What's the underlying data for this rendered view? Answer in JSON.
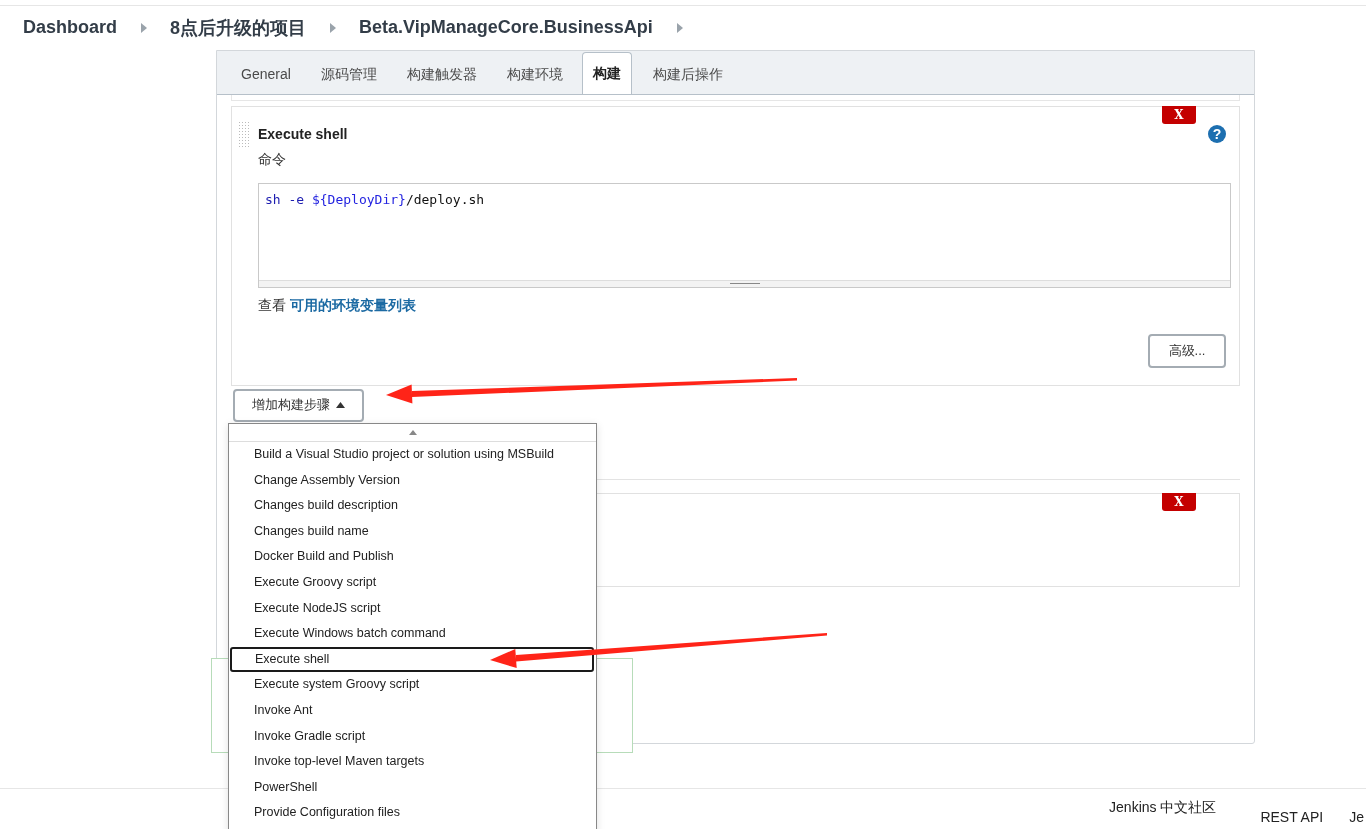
{
  "breadcrumb": [
    {
      "label": "Dashboard"
    },
    {
      "label": "8点后升级的项目"
    },
    {
      "label": "Beta.VipManageCore.BusinessApi"
    }
  ],
  "tabs": [
    {
      "label": "General",
      "selected": false
    },
    {
      "label": "源码管理",
      "selected": false
    },
    {
      "label": "构建触发器",
      "selected": false
    },
    {
      "label": "构建环境",
      "selected": false
    },
    {
      "label": "构建",
      "selected": true
    },
    {
      "label": "构建后操作",
      "selected": false
    }
  ],
  "build_steps": [
    {
      "kind": "shell",
      "title": "Execute shell",
      "delete": "X",
      "help": "?",
      "field_label": "命令",
      "command": [
        {
          "kind": "command",
          "text": "sh -e "
        },
        {
          "kind": "variable",
          "text": "${DeployDir}"
        },
        {
          "kind": "plain",
          "text": "/deploy.sh"
        }
      ],
      "hint": {
        "text": "查看",
        "link": "可用的环境变量列表"
      },
      "advanced_button": "高级..."
    },
    {
      "kind": "blank",
      "delete": "X"
    }
  ],
  "add_step_button": "增加构建步骤",
  "step_menu": {
    "items": [
      {
        "label": "Build a Visual Studio project or solution using MSBuild",
        "selected": false
      },
      {
        "label": "Change Assembly Version",
        "selected": false
      },
      {
        "label": "Changes build description",
        "selected": false
      },
      {
        "label": "Changes build name",
        "selected": false
      },
      {
        "label": "Docker Build and Publish",
        "selected": false
      },
      {
        "label": "Execute Groovy script",
        "selected": false
      },
      {
        "label": "Execute NodeJS script",
        "selected": false
      },
      {
        "label": "Execute Windows batch command",
        "selected": false
      },
      {
        "label": "Execute shell",
        "selected": true
      },
      {
        "label": "Execute system Groovy script",
        "selected": false
      },
      {
        "label": "Invoke Ant",
        "selected": false
      },
      {
        "label": "Invoke Gradle script",
        "selected": false
      },
      {
        "label": "Invoke top-level Maven targets",
        "selected": false
      },
      {
        "label": "PowerShell",
        "selected": false
      },
      {
        "label": "Provide Configuration files",
        "selected": false
      }
    ]
  },
  "footer": {
    "links": [
      "Jenkins 中文社区",
      "REST API",
      "Je"
    ]
  }
}
